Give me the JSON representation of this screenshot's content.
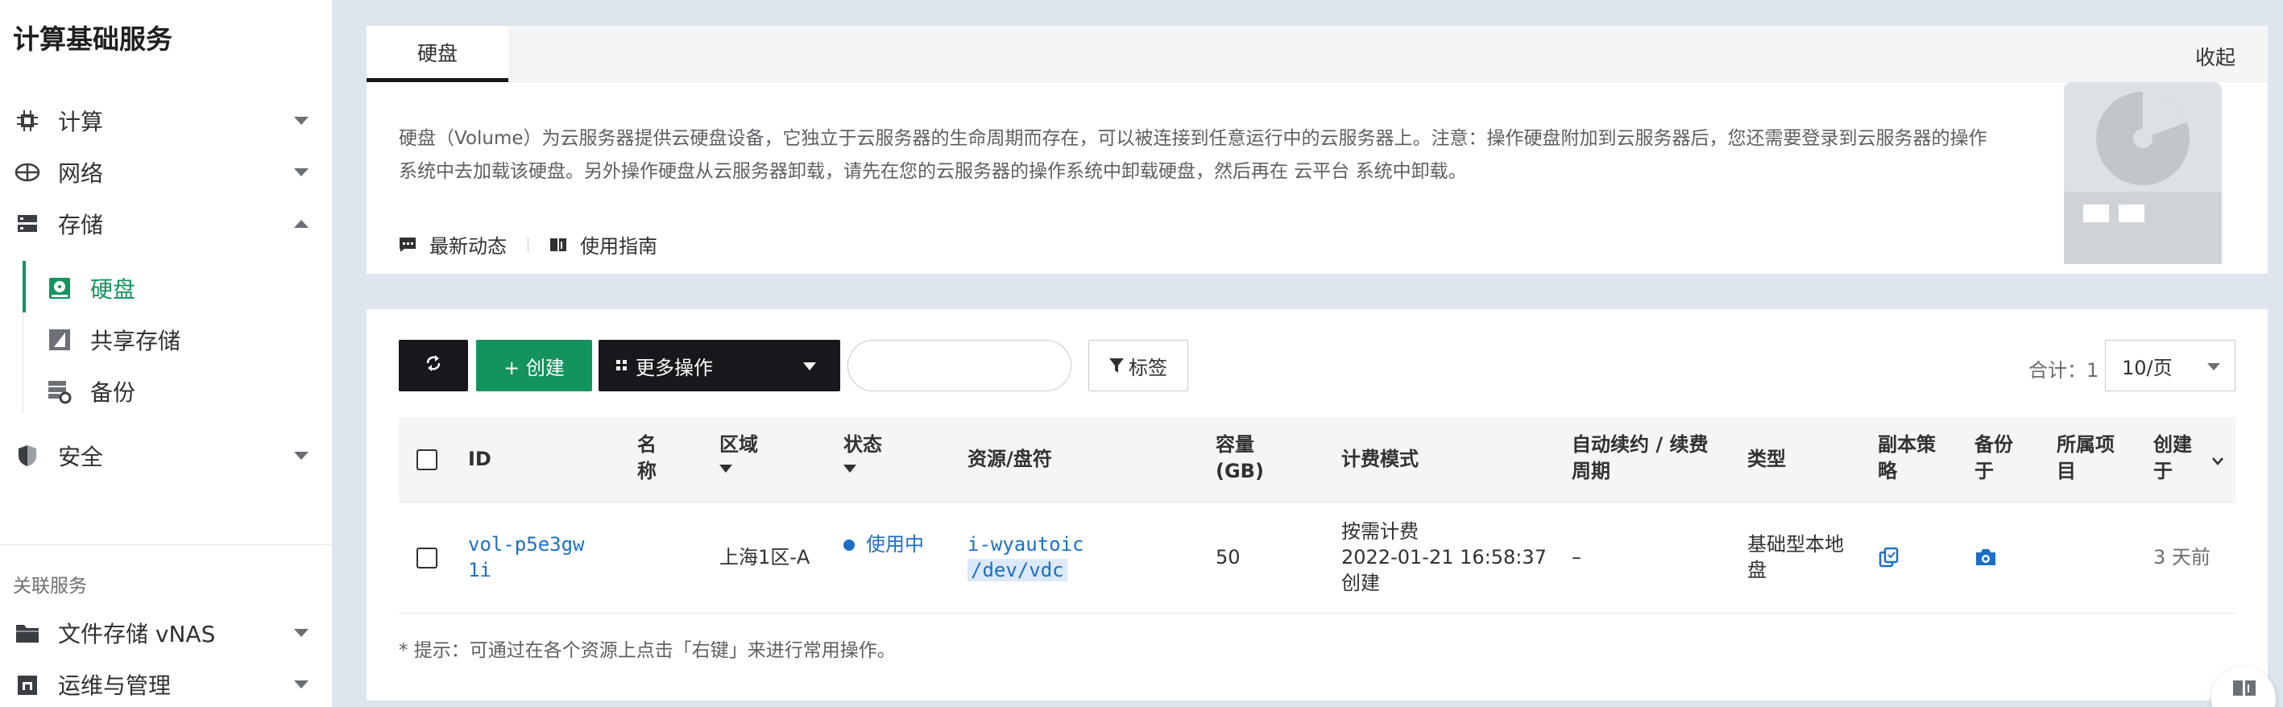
{
  "sidebar": {
    "title": "计算基础服务",
    "items": [
      {
        "label": "计算",
        "icon": "chip-icon"
      },
      {
        "label": "网络",
        "icon": "network-icon"
      },
      {
        "label": "存储",
        "icon": "storage-icon"
      }
    ],
    "storage_sub": [
      {
        "label": "硬盘",
        "icon": "disk-icon"
      },
      {
        "label": "共享存储",
        "icon": "shared-storage-icon"
      },
      {
        "label": "备份",
        "icon": "backup-icon"
      }
    ],
    "security": {
      "label": "安全",
      "icon": "shield-icon"
    },
    "related_title": "关联服务",
    "related": [
      {
        "label": "文件存储 vNAS",
        "icon": "folder-icon"
      },
      {
        "label": "运维与管理",
        "icon": "ops-icon"
      }
    ]
  },
  "info": {
    "tab": "硬盘",
    "collapse": "收起",
    "description": "硬盘（Volume）为云服务器提供云硬盘设备，它独立于云服务器的生命周期而存在，可以被连接到任意运行中的云服务器上。注意：操作硬盘附加到云服务器后，您还需要登录到云服务器的操作系统中去加载该硬盘。另外操作硬盘从云服务器卸载，请先在您的云服务器的操作系统中卸载硬盘，然后再在 云平台 系统中卸载。",
    "link_news": "最新动态",
    "link_guide": "使用指南"
  },
  "toolbar": {
    "create": "+ 创建",
    "more": "更多操作",
    "search_placeholder": "",
    "tag": "标签",
    "total": "合计：1",
    "page_size": "10/页"
  },
  "table": {
    "headers": {
      "id": "ID",
      "name": "名称",
      "zone": "区域",
      "status": "状态",
      "resource": "资源/盘符",
      "capacity": "容量(GB)",
      "billing": "计费模式",
      "renew": "自动续约 / 续费周期",
      "type": "类型",
      "replica": "副本策略",
      "backup": "备份于",
      "project": "所属项目",
      "created": "创建于"
    },
    "rows": [
      {
        "id": "vol-p5e3gw1i",
        "name": "",
        "zone": "上海1区-A",
        "status": "使用中",
        "resource_instance": "i-wyautoic",
        "resource_device": "/dev/vdc",
        "capacity": "50",
        "billing_mode": "按需计费",
        "billing_time": "2022-01-21 16:58:37",
        "billing_action": "创建",
        "renew": "–",
        "type": "基础型本地盘",
        "project": "",
        "created": "3 天前"
      }
    ]
  },
  "hint": "* 提示：可通过在各个资源上点击「右键」来进行常用操作。",
  "colors": {
    "accent": "#14955f",
    "link": "#1c6fc4",
    "dark_button": "#16181b"
  }
}
